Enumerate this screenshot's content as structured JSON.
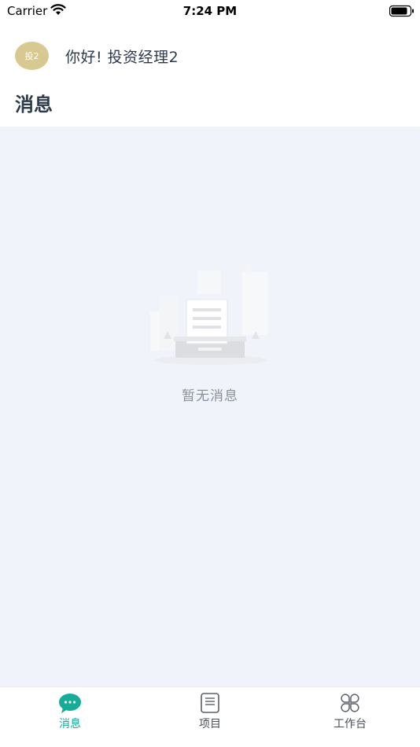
{
  "status_bar": {
    "carrier": "Carrier",
    "time": "7:24 PM"
  },
  "header": {
    "avatar_text": "投2",
    "greeting": "你好! 投资经理2"
  },
  "page": {
    "title": "消息"
  },
  "empty_state": {
    "message": "暂无消息"
  },
  "tab_bar": {
    "tabs": [
      {
        "label": "消息",
        "icon": "chat-bubble-icon",
        "active": true
      },
      {
        "label": "项目",
        "icon": "document-icon",
        "active": false
      },
      {
        "label": "工作台",
        "icon": "workbench-icon",
        "active": false
      }
    ]
  },
  "colors": {
    "accent": "#15ad9a",
    "avatar_bg": "#d8c891",
    "content_bg": "#f0f3f9",
    "title_text": "#2d3a4b"
  }
}
